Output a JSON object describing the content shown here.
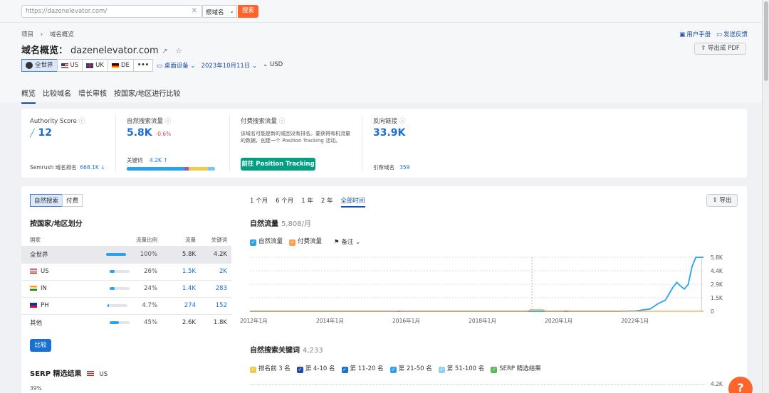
{
  "topbar": {
    "url": "https://dazenelevator.com/",
    "mode": "根域名",
    "search_label": "搜索"
  },
  "breadcrumb": {
    "root": "项目",
    "sep": "›",
    "current": "域名概览"
  },
  "help": {
    "manual": "用户手册",
    "feedback": "发送反馈"
  },
  "page": {
    "title": "域名概览：",
    "domain": "dazenelevator.com",
    "export_pdf": "导出成 PDF"
  },
  "databases": [
    {
      "label": "全世界"
    },
    {
      "label": "US"
    },
    {
      "label": "UK"
    },
    {
      "label": "DE"
    },
    {
      "label": "•••"
    }
  ],
  "filters": {
    "device": "桌面设备",
    "date": "2023年10月11日",
    "currency": "USD"
  },
  "tabs": [
    "概览",
    "比较域名",
    "增长审核",
    "按国家/地区进行比较"
  ],
  "kpis": {
    "authority": {
      "label": "Authority Score",
      "value": "12",
      "rank_label": "Semrush 域名排名",
      "rank_value": "668.1K"
    },
    "organic": {
      "label": "自然搜索流量",
      "value": "5.8K",
      "change": "-0.6%",
      "kw_label": "关键词",
      "kw_value": "4.2K"
    },
    "paid": {
      "label": "付费搜索流量",
      "desc": "该域名可能是新的或因没有排名。要获得有机流量的数据，创建一个 Position Tracking 活动。",
      "button": "前往 Position Tracking"
    },
    "backlinks": {
      "label": "反向链接",
      "value": "33.9K",
      "ref_label": "引荐域名",
      "ref_value": "359"
    }
  },
  "traffic_toggle": [
    "自然搜索",
    "付费"
  ],
  "country_section": {
    "title": "按国家/地区划分",
    "headers": [
      "国家",
      "流量比例",
      "流量",
      "关键词"
    ],
    "rows": [
      {
        "name": "全世界",
        "pct": "100%",
        "share": 100,
        "traffic": "5.8K",
        "kw": "4.2K",
        "flag": "globe"
      },
      {
        "name": "US",
        "pct": "26%",
        "share": 26,
        "traffic": "1.5K",
        "kw": "2K",
        "flag": "us"
      },
      {
        "name": "IN",
        "pct": "24%",
        "share": 24,
        "traffic": "1.4K",
        "kw": "283",
        "flag": "in"
      },
      {
        "name": "PH",
        "pct": "4.7%",
        "share": 4.7,
        "traffic": "274",
        "kw": "152",
        "flag": "ph"
      },
      {
        "name": "其他",
        "pct": "45%",
        "share": 45,
        "traffic": "2.6K",
        "kw": "1.8K",
        "flag": "none"
      }
    ],
    "compare": "比较"
  },
  "serp": {
    "title": "SERP 精选结果",
    "db": "US",
    "axis_top": "39%"
  },
  "periods": [
    "1 个月",
    "6 个月",
    "1 年",
    "2 年",
    "全部时间"
  ],
  "export_label": "导出",
  "traffic_chart": {
    "title": "自然流量",
    "subtitle": "5,808/月",
    "legend": [
      "自然流量",
      "付费流量"
    ],
    "notes": "备注"
  },
  "kw_chart": {
    "title": "自然搜索关键词",
    "subtitle": "4,233",
    "legend": [
      "排名前 3 名",
      "第 4-10 名",
      "第 11-20 名",
      "第 21-50 名",
      "第 51-100 名",
      "SERP 精选结果"
    ],
    "axis_top": "4.2K"
  },
  "chart_data": {
    "type": "line",
    "title": "自然流量",
    "x_ticks": [
      "2012年1月",
      "2014年1月",
      "2016年1月",
      "2018年1月",
      "2020年1月",
      "2022年1月"
    ],
    "y_ticks": [
      "5.8K",
      "4.4K",
      "2.9K",
      "1.5K",
      "0"
    ],
    "ylim": [
      0,
      5808
    ],
    "xlim": [
      2011.9,
      2023.8
    ],
    "series": [
      {
        "name": "自然流量",
        "color": "#2aa3ef",
        "points": [
          [
            2011.9,
            0
          ],
          [
            2021.5,
            0
          ],
          [
            2022.0,
            30
          ],
          [
            2022.4,
            250
          ],
          [
            2022.6,
            800
          ],
          [
            2022.8,
            1200
          ],
          [
            2023.0,
            2600
          ],
          [
            2023.1,
            3100
          ],
          [
            2023.2,
            2700
          ],
          [
            2023.3,
            2400
          ],
          [
            2023.4,
            2900
          ],
          [
            2023.5,
            4800
          ],
          [
            2023.6,
            5808
          ],
          [
            2023.7,
            5800
          ],
          [
            2023.8,
            5808
          ]
        ]
      },
      {
        "name": "付费流量",
        "color": "#ff9f4a",
        "points": [
          [
            2011.9,
            0
          ],
          [
            2015.7,
            0
          ],
          [
            2015.8,
            60
          ],
          [
            2015.9,
            0
          ],
          [
            2019.2,
            0
          ],
          [
            2019.25,
            160
          ],
          [
            2019.6,
            160
          ],
          [
            2019.65,
            0
          ],
          [
            2020.1,
            0
          ],
          [
            2020.2,
            80
          ],
          [
            2020.3,
            0
          ],
          [
            2023.8,
            0
          ]
        ]
      }
    ]
  }
}
